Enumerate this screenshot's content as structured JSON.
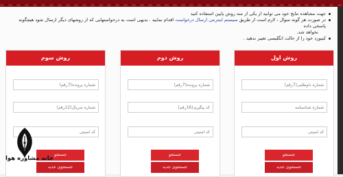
{
  "instructions": [
    "جهت مشاهده نتایج خود می توانید از یکی از سه روش پایین استفاده کنید",
    "در صورت هر گونه سوال ، لازم است از طریق",
    "سیستم اینترنتی ارسال درخواست",
    "اقدام نمایید . بدیهی است به درخواستهایی که از روشهای دیگر ارسال شود هیچگونه پاسخی داده",
    "نخواهد شد.",
    "کیبورد خود را از حالت انگلیسی تغییر ندهید ."
  ],
  "panels": {
    "first": {
      "title": "روش اول",
      "field1": "شماره داوطلبی(7رقم)",
      "field2": "شماره شناسنامه",
      "field3": "کد امنیتی",
      "primary": "جستجو",
      "secondary": "جستجوی جدید"
    },
    "second": {
      "title": "روش دوم",
      "field1": "شماره پرونده(7رقم)",
      "field2": "کد پیگیری(16رقم)",
      "field3": "کد امنیتی",
      "primary": "جستجو",
      "secondary": "جستجوی جدید"
    },
    "third": {
      "title": "روش سوم",
      "field1": "شماره پرونده(7رقم)",
      "field2": "شماره سریال(12رقم)",
      "field3": "کد امنیتی",
      "primary": "جستجو",
      "secondary": "جستجوی جدید"
    }
  },
  "logo": {
    "text": "خانه مشاوره هوا",
    "icon": "pen-nib-icon"
  },
  "colors": {
    "header_red": "#d61d24",
    "button_red": "#d9262c",
    "top_band": "#7e0a12",
    "link_blue": "#2a3fa6"
  }
}
